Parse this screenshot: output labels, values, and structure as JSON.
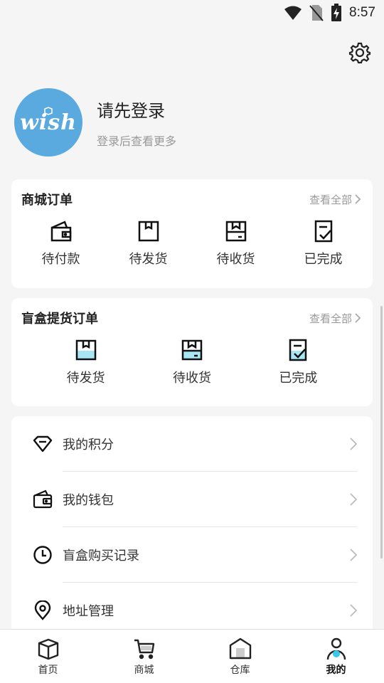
{
  "status_bar": {
    "time": "8:57"
  },
  "profile": {
    "avatar_text": "wish",
    "title": "请先登录",
    "subtitle": "登录后查看更多"
  },
  "mall_orders": {
    "title": "商城订单",
    "view_all": "查看全部",
    "items": [
      {
        "label": "待付款",
        "icon": "wallet-icon"
      },
      {
        "label": "待发货",
        "icon": "box-icon"
      },
      {
        "label": "待收货",
        "icon": "box-open-icon"
      },
      {
        "label": "已完成",
        "icon": "check-doc-icon"
      }
    ]
  },
  "blindbox_orders": {
    "title": "盲盒提货订单",
    "view_all": "查看全部",
    "items": [
      {
        "label": "待发货",
        "icon": "box-icon"
      },
      {
        "label": "待收货",
        "icon": "box-open-icon"
      },
      {
        "label": "已完成",
        "icon": "check-doc-icon"
      }
    ]
  },
  "menu": [
    {
      "label": "我的积分",
      "icon": "diamond-icon"
    },
    {
      "label": "我的钱包",
      "icon": "wallet-icon"
    },
    {
      "label": "盲盒购买记录",
      "icon": "clock-icon"
    },
    {
      "label": "地址管理",
      "icon": "location-pin-icon"
    }
  ],
  "tabs": [
    {
      "label": "首页",
      "icon": "box-icon"
    },
    {
      "label": "商城",
      "icon": "cart-icon"
    },
    {
      "label": "仓库",
      "icon": "warehouse-icon"
    },
    {
      "label": "我的",
      "icon": "person-icon",
      "active": true
    }
  ],
  "colors": {
    "accent": "#3cc8e8",
    "avatar_bg": "#5aa9df"
  }
}
